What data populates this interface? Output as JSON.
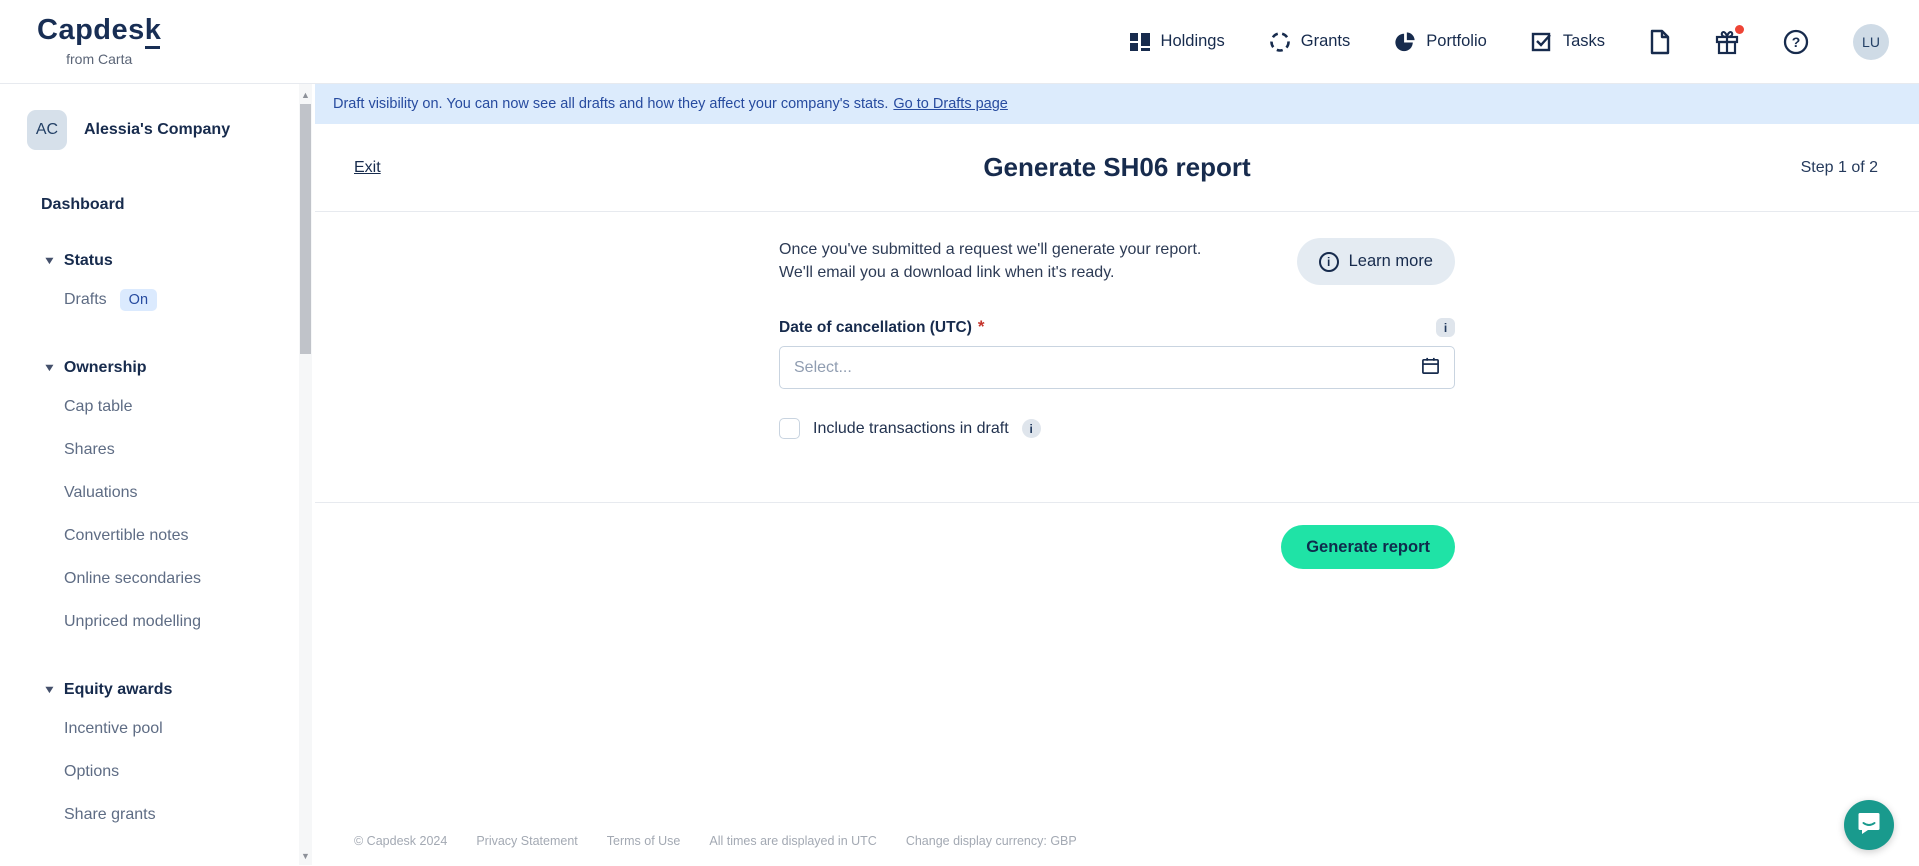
{
  "header": {
    "logo": {
      "brand": "Capdesk",
      "sub": "from Carta"
    },
    "nav": [
      {
        "label": "Holdings",
        "icon": "grid-icon"
      },
      {
        "label": "Grants",
        "icon": "dashed-circle-icon"
      },
      {
        "label": "Portfolio",
        "icon": "pie-chart-icon"
      },
      {
        "label": "Tasks",
        "icon": "checked-box-icon"
      }
    ],
    "avatar_initials": "LU"
  },
  "sidebar": {
    "company": {
      "initials": "AC",
      "name": "Alessia's Company"
    },
    "dashboard_label": "Dashboard",
    "sections": [
      {
        "label": "Status",
        "items": [
          {
            "label": "Drafts",
            "badge": "On"
          }
        ]
      },
      {
        "label": "Ownership",
        "items": [
          {
            "label": "Cap table"
          },
          {
            "label": "Shares"
          },
          {
            "label": "Valuations"
          },
          {
            "label": "Convertible notes"
          },
          {
            "label": "Online secondaries"
          },
          {
            "label": "Unpriced modelling"
          }
        ]
      },
      {
        "label": "Equity awards",
        "items": [
          {
            "label": "Incentive pool"
          },
          {
            "label": "Options"
          },
          {
            "label": "Share grants"
          }
        ]
      }
    ]
  },
  "banner": {
    "text": "Draft visibility on. You can now see all drafts and how they affect your company's stats.",
    "link_label": "Go to Drafts page"
  },
  "wizard": {
    "exit_label": "Exit",
    "title": "Generate SH06 report",
    "step_label": "Step 1 of 2"
  },
  "form": {
    "intro_line1": "Once you've submitted a request we'll generate your report.",
    "intro_line2": "We'll email you a download link when it's ready.",
    "learn_more_label": "Learn more",
    "info_glyph": "i",
    "date_label": "Date of cancellation (UTC)",
    "required_marker": "*",
    "date_placeholder": "Select...",
    "checkbox_label": "Include transactions in draft",
    "submit_label": "Generate report"
  },
  "footer": {
    "copyright": "© Capdesk 2024",
    "privacy": "Privacy Statement",
    "terms": "Terms of Use",
    "utc_note": "All times are displayed in UTC",
    "currency": "Change display currency: GBP"
  },
  "colors": {
    "navy": "#172b4d",
    "accent_green": "#1fe3a6",
    "banner_blue_bg": "#dcebfc",
    "banner_blue_text": "#274b9f",
    "chat_teal": "#199a8d",
    "notification_red": "#ee4436"
  }
}
